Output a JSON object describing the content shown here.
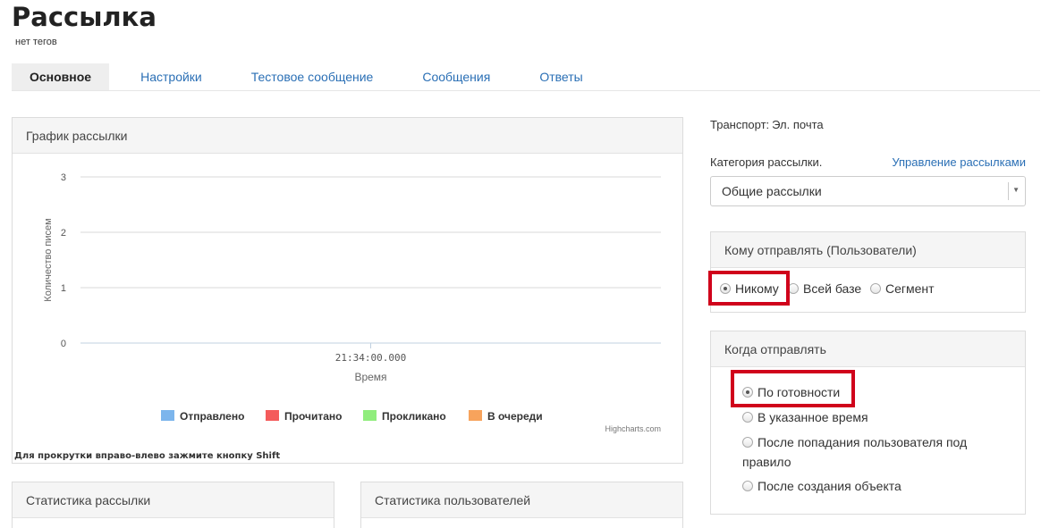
{
  "header": {
    "title": "Рассылка",
    "tags": "нет тегов"
  },
  "tabs": [
    {
      "label": "Основное",
      "active": true
    },
    {
      "label": "Настройки"
    },
    {
      "label": "Тестовое сообщение"
    },
    {
      "label": "Сообщения"
    },
    {
      "label": "Ответы"
    }
  ],
  "chart_panel": {
    "title": "График рассылки",
    "scroll_hint": "Для прокрутки вправо-влево зажмите кнопку Shift",
    "credits": "Highcharts.com"
  },
  "chart_data": {
    "type": "line",
    "x": [
      "21:34:00.000"
    ],
    "xlabel": "Время",
    "ylabel": "Количество писем",
    "yticks": [
      0,
      1,
      2,
      3
    ],
    "ylim": [
      0,
      3
    ],
    "grid": true,
    "legend_position": "bottom",
    "series": [
      {
        "name": "Отправлено",
        "color": "#7cb5ec",
        "values": [
          0
        ]
      },
      {
        "name": "Прочитано",
        "color": "#f45b5b",
        "values": [
          0
        ]
      },
      {
        "name": "Прокликано",
        "color": "#90ed7d",
        "values": [
          0
        ]
      },
      {
        "name": "В очереди",
        "color": "#f7a35c",
        "values": [
          0
        ]
      }
    ]
  },
  "stats_panel": {
    "title": "Статистика рассылки"
  },
  "users_panel": {
    "title": "Статистика пользователей"
  },
  "side": {
    "transport_label": "Транспорт:",
    "transport_value": "Эл. почта",
    "category_label": "Категория рассылки.",
    "manage_link": "Управление рассылками",
    "category_value": "Общие рассылки"
  },
  "who": {
    "title": "Кому отправлять (Пользователи)",
    "options": [
      {
        "label": "Никому",
        "checked": true
      },
      {
        "label": "Всей базе",
        "checked": false
      },
      {
        "label": "Сегмент",
        "checked": false
      }
    ]
  },
  "when": {
    "title": "Когда отправлять",
    "options": [
      {
        "label": "По готовности",
        "checked": true
      },
      {
        "label": "В указанное время",
        "checked": false
      },
      {
        "label_line1": "После попадания пользователя под",
        "label_line2": "правило",
        "checked": false
      },
      {
        "label": "После создания объекта",
        "checked": false
      }
    ]
  },
  "colors": {
    "link": "#2a6fb5",
    "highlight": "#d0021b"
  }
}
